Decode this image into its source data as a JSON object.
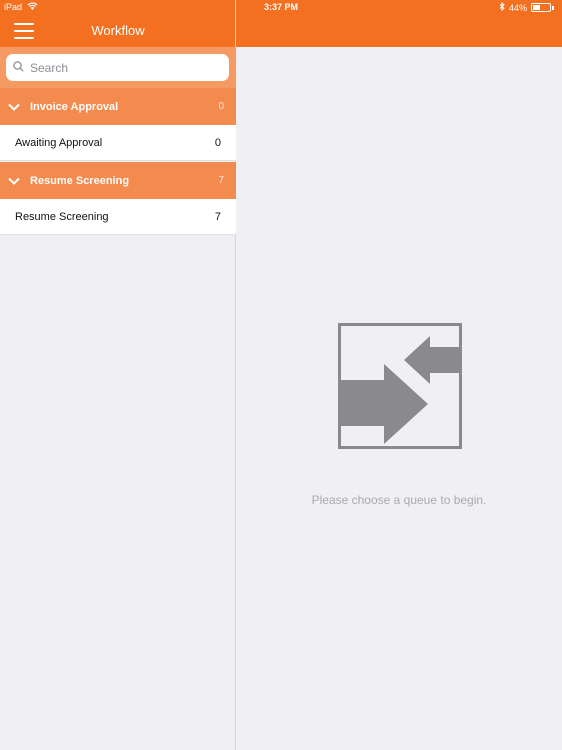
{
  "status_bar": {
    "device": "iPad",
    "time": "3:37 PM",
    "battery": "44%",
    "battery_level": 0.44
  },
  "nav": {
    "title": "Workflow"
  },
  "search": {
    "placeholder": "Search"
  },
  "groups": [
    {
      "title": "Invoice Approval",
      "count": "0",
      "queues": [
        {
          "label": "Awaiting Approval",
          "count": "0"
        }
      ]
    },
    {
      "title": "Resume Screening",
      "count": "7",
      "queues": [
        {
          "label": "Resume Screening",
          "count": "7"
        }
      ]
    }
  ],
  "detail": {
    "empty_message": "Please choose a queue to begin.",
    "empty_icon": "queue-arrows-icon"
  },
  "colors": {
    "brand": "#f37021",
    "group_header": "#f38a4e",
    "background": "#efeff4"
  }
}
